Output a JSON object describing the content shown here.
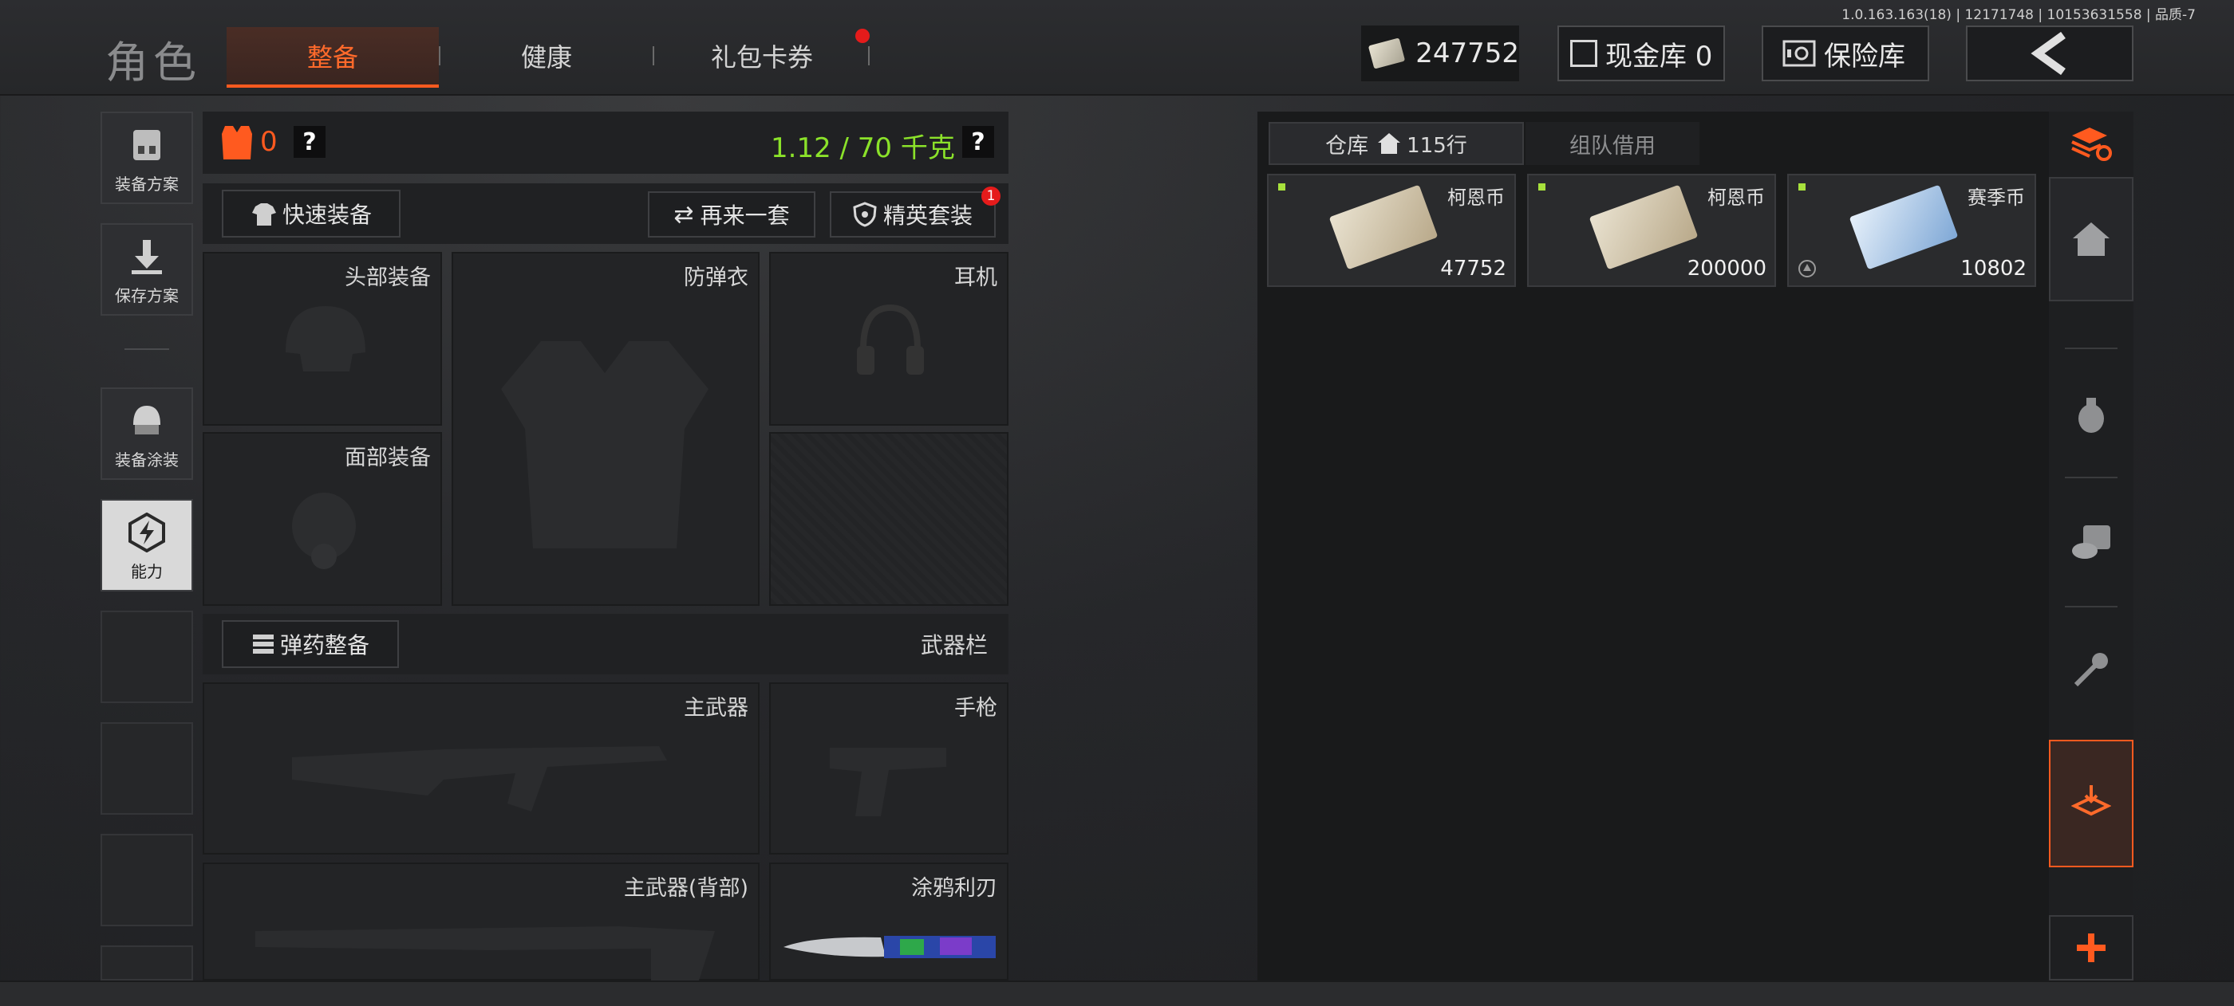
{
  "version": "1.0.163.163(18) | 12171748 | 10153631558 | 品质-7",
  "header": {
    "title": "角色",
    "tabs": [
      {
        "label": "整备",
        "active": true
      },
      {
        "label": "健康",
        "active": false
      },
      {
        "label": "礼包卡券",
        "active": false,
        "notification": true
      }
    ],
    "money": "247752",
    "cash_vault": "现金库 0",
    "safe": "保险库"
  },
  "left_nav": [
    {
      "label": "装备方案",
      "icon": "gear-rig-icon"
    },
    {
      "label": "保存方案",
      "icon": "download-icon"
    },
    {
      "label": "装备涂装",
      "icon": "helmet-paint-icon"
    },
    {
      "label": "能力",
      "icon": "ability-bolt-icon",
      "active": true
    }
  ],
  "equipment": {
    "armor_count": "0",
    "help": "?",
    "weight": "1.12 / 70 千克",
    "quick_equip": "快速装备",
    "again_set": "再来一套",
    "elite_set": "精英套装",
    "elite_badge": "1",
    "slots": {
      "head": "头部装备",
      "vest": "防弹衣",
      "headset": "耳机",
      "face": "面部装备"
    },
    "ammo_btn": "弹药整备",
    "weapon_bar": "武器栏",
    "weapons": {
      "primary": "主武器",
      "pistol": "手枪",
      "primary_back": "主武器(背部)",
      "knife": "涂鸦利刃"
    }
  },
  "warehouse": {
    "tab_storage": "仓库",
    "rows": "115行",
    "tab_team": "组队借用",
    "items": [
      {
        "name": "柯恩币",
        "count": "47752",
        "color": "#d9cdb3"
      },
      {
        "name": "柯恩币",
        "count": "200000",
        "color": "#d9cdb3"
      },
      {
        "name": "赛季币",
        "count": "10802",
        "color": "#9fc4e8"
      }
    ]
  },
  "colors": {
    "accent": "#ff5a1f",
    "weight_green": "#8be22a",
    "flag_green": "#a7e13c"
  }
}
